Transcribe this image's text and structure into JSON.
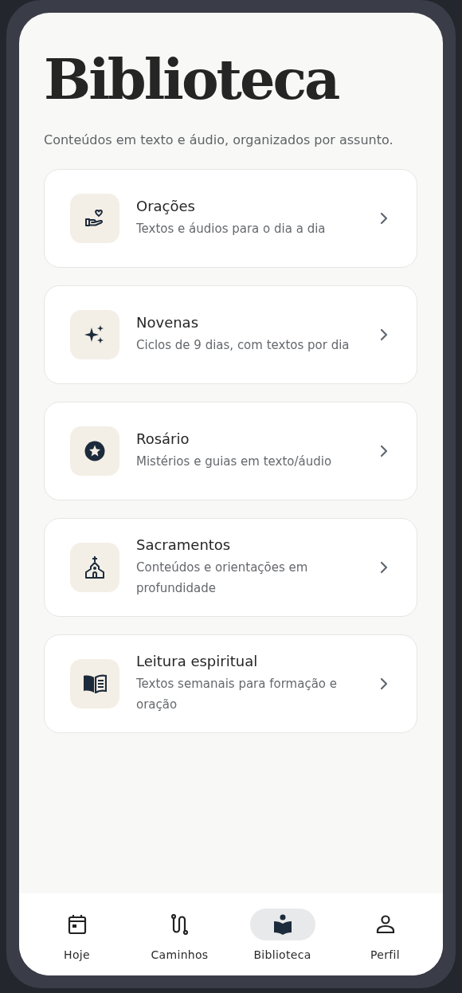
{
  "header": {
    "title": "Biblioteca",
    "subtitle": "Conteúdos em texto e áudio, organizados por assunto."
  },
  "categories": [
    {
      "title": "Orações",
      "description": "Textos e áudios para o dia a dia"
    },
    {
      "title": "Novenas",
      "description": "Ciclos de 9 dias, com textos por dia"
    },
    {
      "title": "Rosário",
      "description": "Mistérios e guias em texto/áudio"
    },
    {
      "title": "Sacramentos",
      "description": "Conteúdos e orientações em profundidade"
    },
    {
      "title": "Leitura espiritual",
      "description": "Textos semanais para formação e oração"
    }
  ],
  "bottom_nav": [
    {
      "label": "Hoje",
      "selected": false
    },
    {
      "label": "Caminhos",
      "selected": false
    },
    {
      "label": "Biblioteca",
      "selected": true
    },
    {
      "label": "Perfil",
      "selected": false
    }
  ]
}
